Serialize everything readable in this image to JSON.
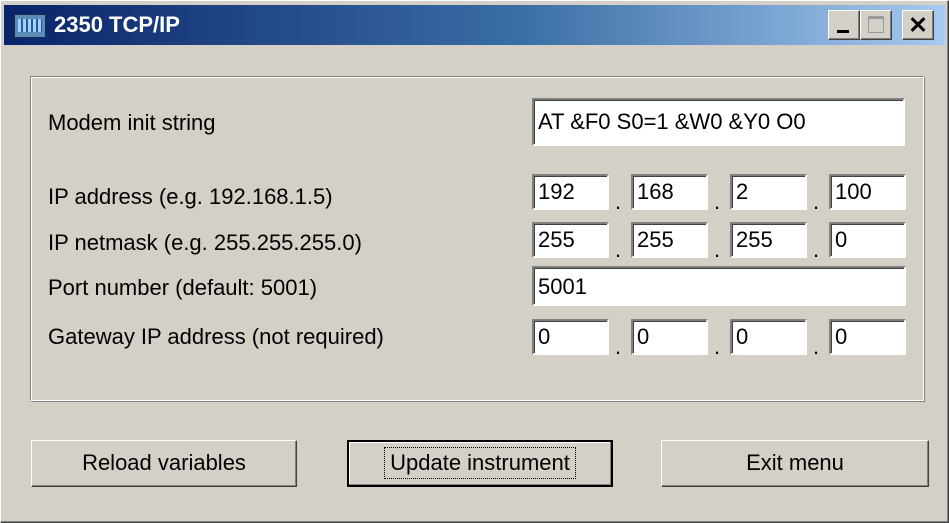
{
  "window": {
    "title": "2350 TCP/IP"
  },
  "fields": {
    "modem_init": {
      "label": "Modem init string",
      "value": "AT &F0 S0=1 &W0 &Y0 O0"
    },
    "ip_address": {
      "label": "IP address (e.g. 192.168.1.5)",
      "octets": [
        "192",
        "168",
        "2",
        "100"
      ]
    },
    "ip_netmask": {
      "label": "IP netmask (e.g. 255.255.255.0)",
      "octets": [
        "255",
        "255",
        "255",
        "0"
      ]
    },
    "port": {
      "label": "Port number (default: 5001)",
      "value": "5001"
    },
    "gateway": {
      "label": "Gateway IP address (not required)",
      "octets": [
        "0",
        "0",
        "0",
        "0"
      ]
    }
  },
  "separator": ".",
  "buttons": {
    "reload": "Reload variables",
    "update": "Update instrument",
    "exit": "Exit menu"
  },
  "colors": {
    "titlebar_start": "#0a246a",
    "titlebar_end": "#a6caf0",
    "face": "#d4d0c8"
  }
}
